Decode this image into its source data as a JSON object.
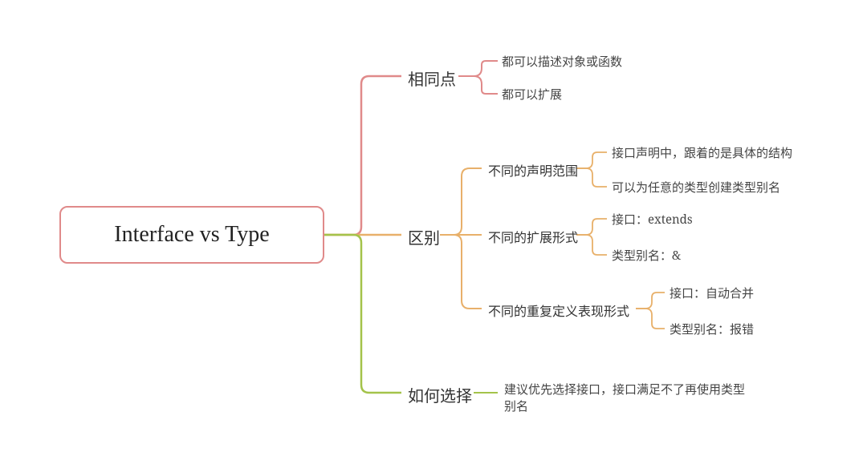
{
  "root": "Interface vs Type",
  "branches": {
    "same": {
      "title": "相同点",
      "items": [
        "都可以描述对象或函数",
        "都可以扩展"
      ]
    },
    "diff": {
      "title": "区别",
      "sub": [
        {
          "title": "不同的声明范围",
          "items": [
            "接口声明中，跟着的是具体的结构",
            "可以为任意的类型创建类型别名"
          ]
        },
        {
          "title": "不同的扩展形式",
          "items": [
            "接口：extends",
            "类型别名：&"
          ]
        },
        {
          "title": "不同的重复定义表现形式",
          "items": [
            "接口：自动合并",
            "类型别名：报错"
          ]
        }
      ]
    },
    "choose": {
      "title": "如何选择",
      "items": [
        "建议优先选择接口，接口满足不了再使用类型别名"
      ]
    }
  },
  "colors": {
    "branch1": "#e08a8a",
    "branch2": "#e8b06a",
    "branch3": "#a4c34a",
    "leaf": "#777"
  }
}
